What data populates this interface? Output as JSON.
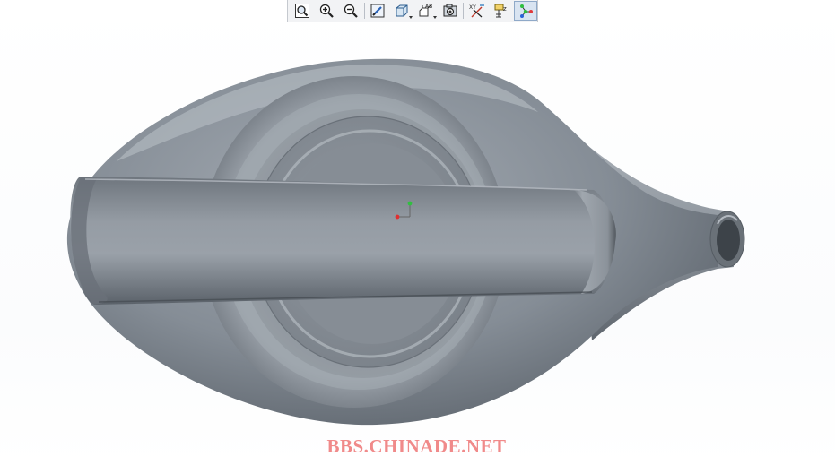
{
  "toolbar": {
    "buttons": [
      {
        "name": "zoom-fit-button",
        "icon": "zoom-fit-icon"
      },
      {
        "name": "zoom-in-button",
        "icon": "zoom-in-icon"
      },
      {
        "name": "zoom-out-button",
        "icon": "zoom-out-icon"
      },
      {
        "name": "repaint-button",
        "icon": "repaint-icon"
      },
      {
        "name": "display-style-button",
        "icon": "cube-icon"
      },
      {
        "name": "saved-views-button",
        "icon": "saved-views-icon"
      },
      {
        "name": "view-manager-button",
        "icon": "camera-icon"
      },
      {
        "name": "datum-display-button",
        "icon": "datum-planes-icon"
      },
      {
        "name": "annotation-display-button",
        "icon": "annotation-icon"
      },
      {
        "name": "spin-center-button",
        "icon": "spin-center-icon"
      }
    ],
    "saved_view_glyph": "AB",
    "datum_glyph": "XY",
    "active_button": "spin-center-button"
  },
  "colors": {
    "model_body": "#8e959e",
    "model_highlight": "#b9bfc6",
    "model_shadow": "#4d535b",
    "axis_x": "#e03030",
    "axis_y": "#30c040",
    "watermark": "#f08a8a"
  },
  "watermark": {
    "text": "BBS.CHINADE.NET"
  }
}
